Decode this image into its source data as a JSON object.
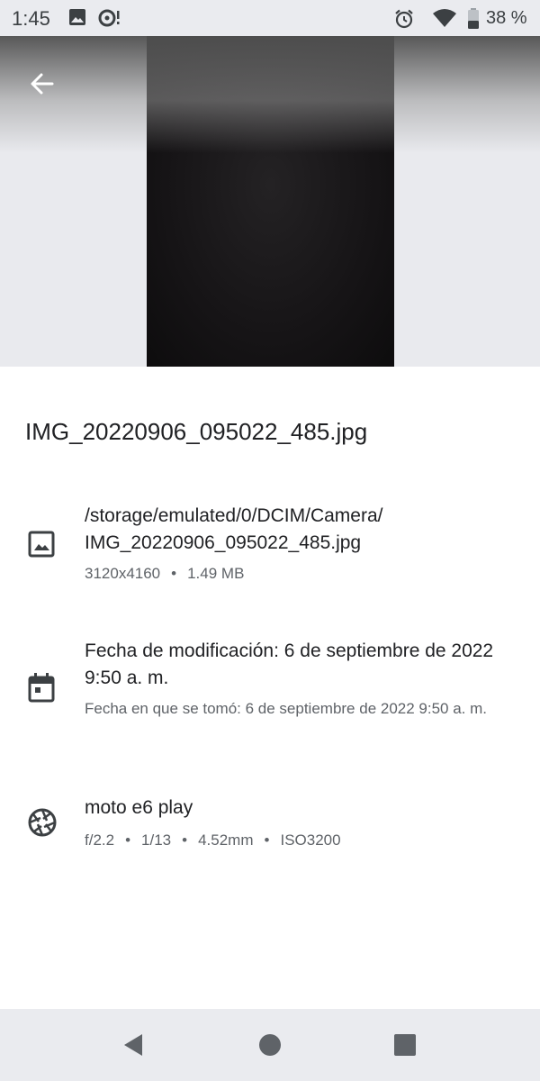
{
  "status_bar": {
    "time": "1:45",
    "battery_percent": "38 %",
    "icons": [
      "gallery-icon",
      "sync-alert-icon",
      "alarm-icon",
      "wifi-icon",
      "battery-icon"
    ]
  },
  "header": {
    "back_icon": "arrow-back-icon"
  },
  "file": {
    "name": "IMG_20220906_095022_485.jpg"
  },
  "details": {
    "path": {
      "icon": "image-icon",
      "line1": "/storage/emulated/0/DCIM/Camera/",
      "line2": "IMG_20220906_095022_485.jpg",
      "resolution": "3120x4160",
      "size": "1.49 MB"
    },
    "date": {
      "icon": "calendar-icon",
      "modified": "Fecha de modificación: 6 de septiembre de 2022 9:50 a. m.",
      "taken": "Fecha en que se tomó: 6 de septiembre de 2022 9:50 a. m."
    },
    "camera": {
      "icon": "aperture-icon",
      "model": "moto e6 play",
      "aperture": "f/2.2",
      "shutter": "1/13",
      "focal_length": "4.52mm",
      "iso": "ISO3200"
    }
  },
  "nav_bar": {
    "icons": [
      "back-triangle-icon",
      "home-circle-icon",
      "recents-square-icon"
    ]
  },
  "colors": {
    "background": "#ffffff",
    "status_bar": "#eaebef",
    "text_primary": "#202124",
    "text_secondary": "#5f6368",
    "icon": "#3c4043"
  }
}
